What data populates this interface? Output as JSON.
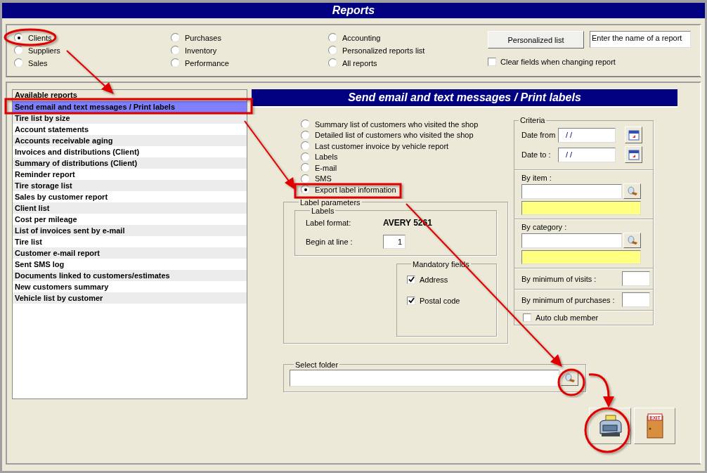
{
  "window": {
    "title": "Reports"
  },
  "report_groups": [
    {
      "label": "Clients",
      "selected": true
    },
    {
      "label": "Suppliers",
      "selected": false
    },
    {
      "label": "Sales",
      "selected": false
    },
    {
      "label": "Purchases",
      "selected": false
    },
    {
      "label": "Inventory",
      "selected": false
    },
    {
      "label": "Performance",
      "selected": false
    },
    {
      "label": "Accounting",
      "selected": false
    },
    {
      "label": "Personalized reports list",
      "selected": false
    },
    {
      "label": "All reports",
      "selected": false
    }
  ],
  "personalized_button": "Personalized list",
  "report_name_field": {
    "value": "Enter the name of a report"
  },
  "clear_fields": {
    "label": "Clear fields when changing report",
    "checked": false
  },
  "reports_list": {
    "header": "Available reports",
    "items": [
      {
        "label": "Send email and text messages / Print labels",
        "selected": true
      },
      {
        "label": "Tire list by size",
        "selected": false
      },
      {
        "label": "Account statements",
        "selected": false
      },
      {
        "label": "Accounts receivable aging",
        "selected": false
      },
      {
        "label": "Invoices and distributions (Client)",
        "selected": false
      },
      {
        "label": "Summary of distributions (Client)",
        "selected": false
      },
      {
        "label": "Reminder report",
        "selected": false
      },
      {
        "label": "Tire storage list",
        "selected": false
      },
      {
        "label": "Sales by customer report",
        "selected": false
      },
      {
        "label": "Client list",
        "selected": false
      },
      {
        "label": "Cost per mileage",
        "selected": false
      },
      {
        "label": "List of invoices sent by e-mail",
        "selected": false
      },
      {
        "label": "Tire list",
        "selected": false
      },
      {
        "label": "Customer e-mail report",
        "selected": false
      },
      {
        "label": "Sent SMS log",
        "selected": false
      },
      {
        "label": "Documents linked to customers/estimates",
        "selected": false
      },
      {
        "label": "New customers summary",
        "selected": false
      },
      {
        "label": "Vehicle list by customer",
        "selected": false
      }
    ]
  },
  "panel_title": "Send email and text messages / Print labels",
  "report_options": [
    {
      "label": "Summary list of customers who visited the shop",
      "selected": false
    },
    {
      "label": "Detailed list of customers who visited the shop",
      "selected": false
    },
    {
      "label": "Last customer invoice by vehicle report",
      "selected": false
    },
    {
      "label": "Labels",
      "selected": false
    },
    {
      "label": "E-mail",
      "selected": false
    },
    {
      "label": "SMS",
      "selected": false
    },
    {
      "label": "Export label information",
      "selected": true
    }
  ],
  "label_parameters": {
    "title": "Label parameters",
    "labels_group": "Labels",
    "format_label": "Label format:",
    "format_value": "AVERY 5261",
    "begin_label": "Begin at line :",
    "begin_value": "1",
    "mandatory_title": "Mandatory fields",
    "mandatory": [
      {
        "label": "Address",
        "checked": true
      },
      {
        "label": "Postal code",
        "checked": true
      }
    ]
  },
  "criteria": {
    "title": "Criteria",
    "date_from": {
      "label": "Date from",
      "value": "/ /"
    },
    "date_to": {
      "label": "Date to :",
      "value": "/ /"
    },
    "by_item": "By item :",
    "by_category": "By category :",
    "min_visits": "By minimum of visits :",
    "min_purchases": "By minimum of purchases :",
    "auto_club": {
      "label": "Auto club member",
      "checked": false
    }
  },
  "select_folder": {
    "title": "Select folder"
  },
  "exit_sign": "EXIT"
}
